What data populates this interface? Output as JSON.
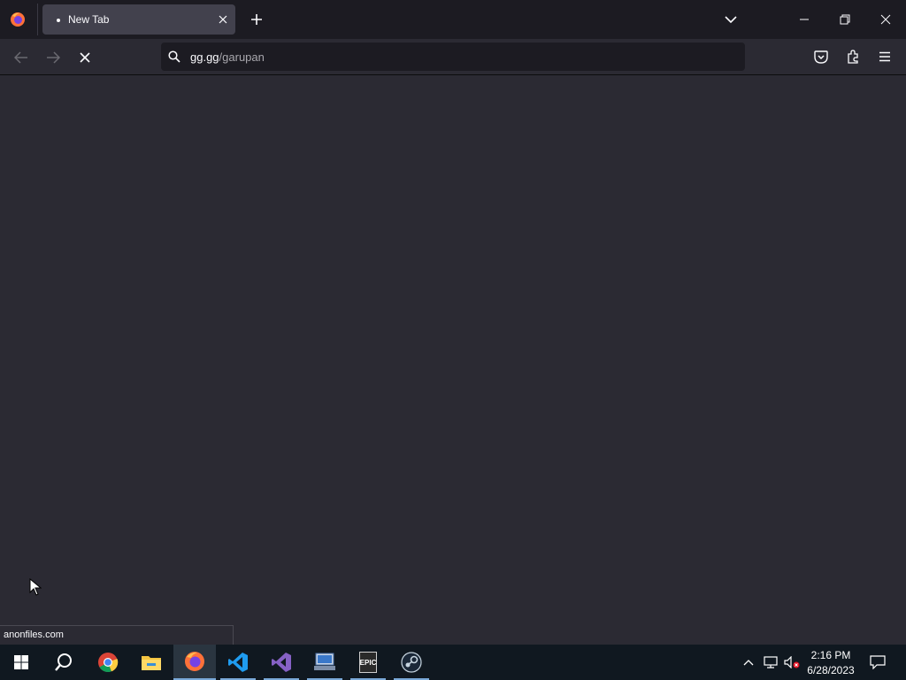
{
  "window": {
    "title": "New Tab"
  },
  "tabs": [
    {
      "label": "New Tab",
      "active": true
    }
  ],
  "urlbar": {
    "host": "gg.gg",
    "path": "/garupan"
  },
  "status": {
    "text": "anonfiles.com"
  },
  "taskbar": {
    "apps": [
      "start-icon",
      "search-icon",
      "chrome-icon",
      "file-explorer-icon",
      "firefox-icon",
      "vscode-icon",
      "visual-studio-icon",
      "app-icon",
      "epic-games-icon",
      "steam-icon"
    ],
    "epic_label": "EPIC",
    "time": "2:16 PM",
    "date": "6/28/2023"
  },
  "colors": {
    "toolbar": "#2b2a33",
    "tabstrip": "#1c1b22",
    "taskbar": "#101820",
    "accent": "#7aa9d8"
  }
}
